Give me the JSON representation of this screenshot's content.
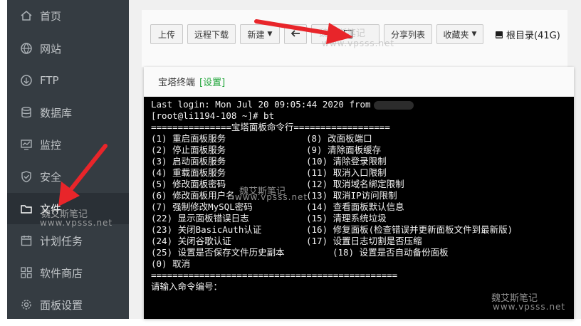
{
  "sidebar": {
    "items": [
      {
        "label": "首页",
        "icon": "home-icon"
      },
      {
        "label": "网站",
        "icon": "globe-icon"
      },
      {
        "label": "FTP",
        "icon": "ftp-icon"
      },
      {
        "label": "数据库",
        "icon": "database-icon"
      },
      {
        "label": "监控",
        "icon": "monitor-icon"
      },
      {
        "label": "安全",
        "icon": "shield-icon"
      },
      {
        "label": "文件",
        "icon": "folder-icon",
        "active": true
      },
      {
        "label": "计划任务",
        "icon": "calendar-icon"
      },
      {
        "label": "软件商店",
        "icon": "grid-icon"
      },
      {
        "label": "面板设置",
        "icon": "gear-icon"
      }
    ]
  },
  "toolbar": {
    "upload": "上传",
    "remote_download": "远程下载",
    "new": "新建",
    "back_icon": "arrow-left-icon",
    "terminal": "终端",
    "share_list": "分享列表",
    "favorites": "收藏夹",
    "disk": "根目录(41G)"
  },
  "dialog": {
    "title": "宝塔终端",
    "settings": "[设置]"
  },
  "terminal": {
    "login": "Last login: Mon Jul 20 09:05:44 2020 from",
    "prompt": "[root@li1194-108 ~]# bt",
    "header": "===============宝塔面板命令行==================",
    "rows": [
      [
        "(1) 重启面板服务",
        "(8) 改面板端口"
      ],
      [
        "(2) 停止面板服务",
        "(9) 清除面板缓存"
      ],
      [
        "(3) 启动面板服务",
        "(10) 清除登录限制"
      ],
      [
        "(4) 重载面板服务",
        "(11) 取消入口限制"
      ],
      [
        "(5) 修改面板密码",
        "(12) 取消域名绑定限制"
      ],
      [
        "(6) 修改面板用户名",
        "(13) 取消IP访问限制"
      ],
      [
        "(7) 强制修改MySQL密码",
        "(14) 查看面板默认信息"
      ],
      [
        "(22) 显示面板错误日志",
        "(15) 清理系统垃圾"
      ],
      [
        "(23) 关闭BasicAuth认证",
        "(16) 修复面板(检查错误并更新面板文件到最新版)"
      ],
      [
        "(24) 关闭谷歌认证",
        "(17) 设置日志切割是否压缩"
      ],
      [
        "(25) 设置是否保存文件历史副本",
        "(18) 设置是否自动备份面板"
      ]
    ],
    "cancel": "(0) 取消",
    "footer": "==============================================",
    "input_prompt": "请输入命令编号："
  },
  "watermark": {
    "name": "魏艾斯笔记",
    "url": "www.vpsss.net"
  },
  "colors": {
    "sidebar_bg": "#353c42",
    "accent_green": "#20a53a",
    "arrow_red": "#e8252a",
    "terminal_bg": "#000000"
  }
}
